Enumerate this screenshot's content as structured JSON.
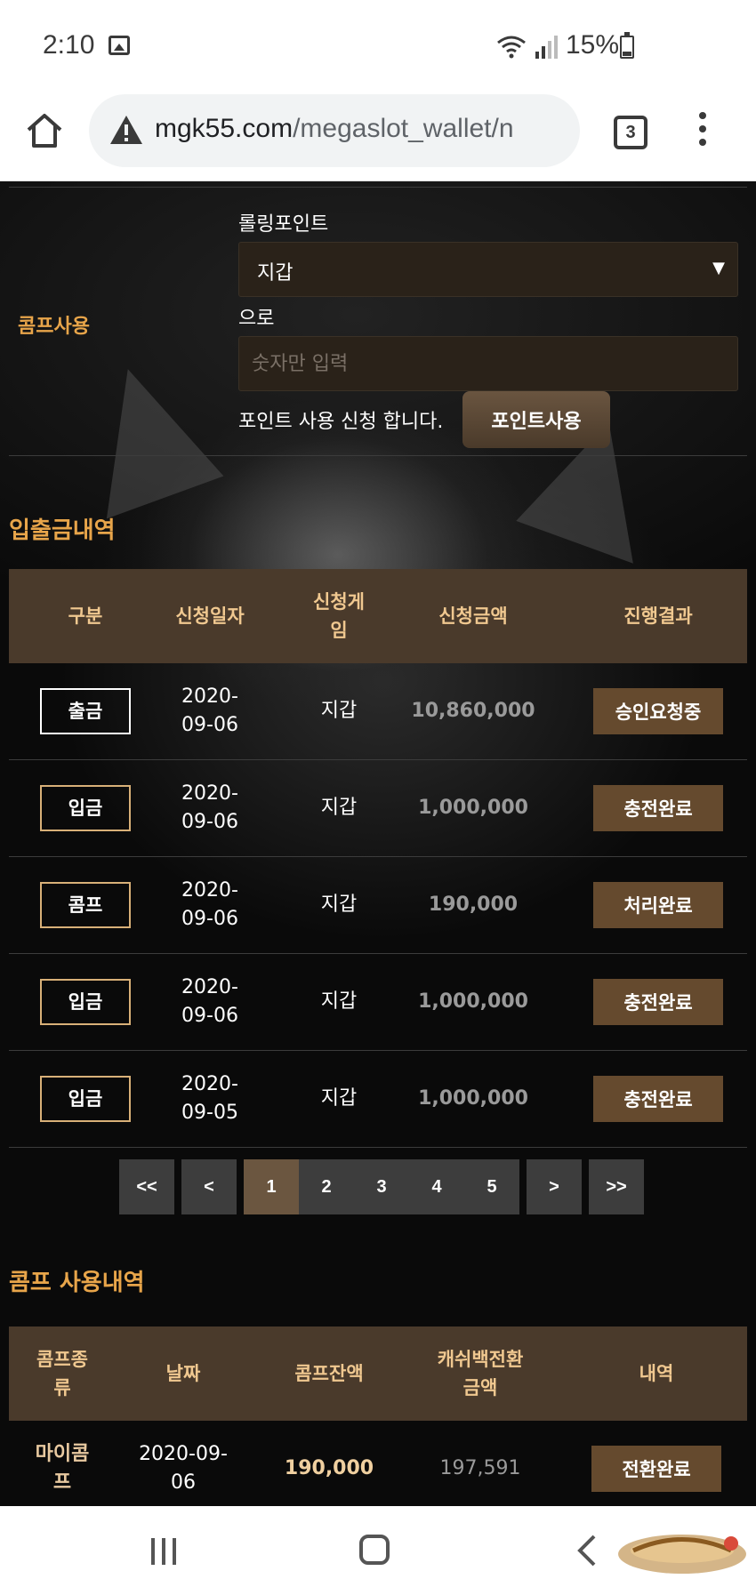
{
  "status_bar": {
    "time": "2:10",
    "battery": "15%",
    "icons": [
      "gallery-icon",
      "wifi-icon",
      "signal-icon",
      "battery-icon"
    ]
  },
  "browser": {
    "url_domain": "mgk55.com",
    "url_path": "/megaslot_wallet/n",
    "tab_count": "3",
    "icons": [
      "home-icon",
      "warning-icon",
      "tabs-icon",
      "more-menu-icon"
    ]
  },
  "comp_form": {
    "section_label": "콤프사용",
    "rolling_point_label": "롤링포인트",
    "select_value": "지갑",
    "to_label": "으로",
    "amount_placeholder": "숫자만 입력",
    "request_text": "포인트 사용 신청 합니다.",
    "submit_label": "포인트사용"
  },
  "transactions": {
    "title": "입출금내역",
    "headers": [
      "구분",
      "신청일자",
      "신청게\n임",
      "신청금액",
      "진행결과"
    ],
    "rows": [
      {
        "type": "출금",
        "date": "2020-\n09-06",
        "game": "지갑",
        "amount": "10,860,000",
        "status": "승인요청중"
      },
      {
        "type": "입금",
        "date": "2020-\n09-06",
        "game": "지갑",
        "amount": "1,000,000",
        "status": "충전완료"
      },
      {
        "type": "콤프",
        "date": "2020-\n09-06",
        "game": "지갑",
        "amount": "190,000",
        "status": "처리완료"
      },
      {
        "type": "입금",
        "date": "2020-\n09-06",
        "game": "지갑",
        "amount": "1,000,000",
        "status": "충전완료"
      },
      {
        "type": "입금",
        "date": "2020-\n09-05",
        "game": "지갑",
        "amount": "1,000,000",
        "status": "충전완료"
      }
    ]
  },
  "pagination": {
    "first": "<<",
    "prev": "<",
    "pages": [
      "1",
      "2",
      "3",
      "4",
      "5"
    ],
    "current": "1",
    "next": ">",
    "last": ">>"
  },
  "comp_history": {
    "title": "콤프 사용내역",
    "headers": [
      "콤프종\n류",
      "날짜",
      "콤프잔액",
      "캐쉬백전환\n금액",
      "내역"
    ],
    "rows": [
      {
        "kind": "마이콤\n프",
        "date": "2020-09-\n06",
        "balance": "190,000",
        "cashback": "197,591",
        "status": "전환완료"
      }
    ]
  },
  "nav_bar": {
    "icons": [
      "recent-apps-icon",
      "home-icon",
      "back-icon"
    ]
  },
  "colors": {
    "accent": "#e8a54a",
    "table_header_bg": "#4a3a2b",
    "status_button_bg": "#654a2e",
    "badge_border": "#d8b078"
  }
}
